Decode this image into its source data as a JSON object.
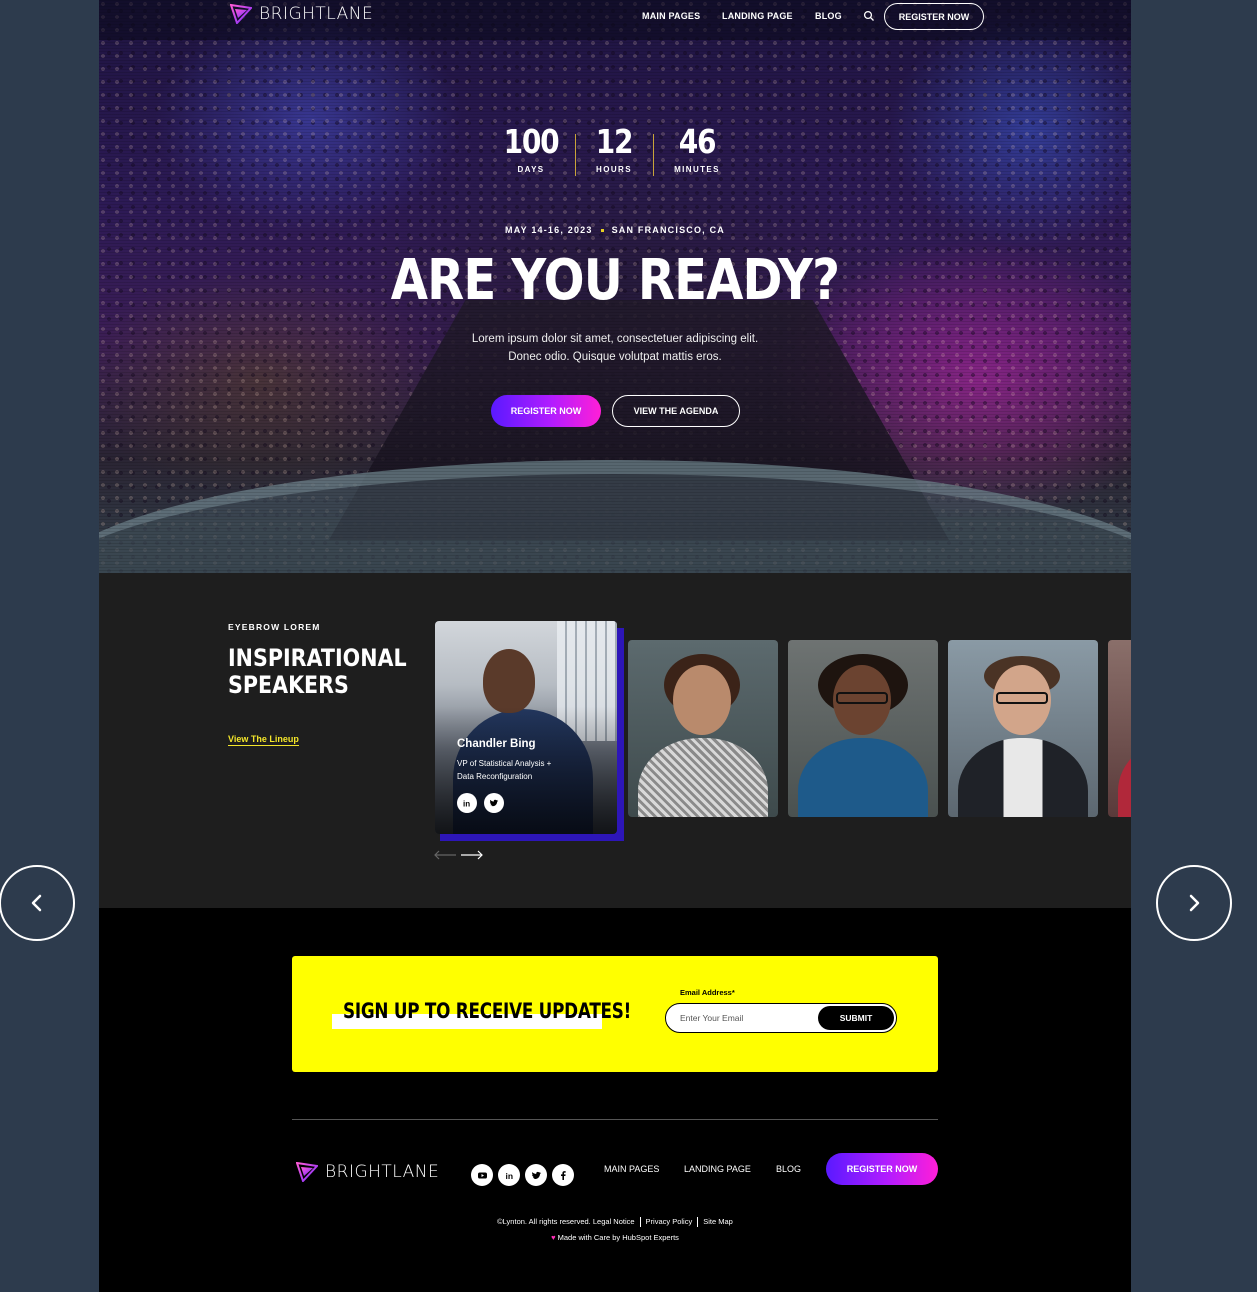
{
  "brand": {
    "name": "BRIGHTLANE",
    "accent_from": "#5a1aff",
    "accent_to": "#ff1fd7",
    "highlight": "#ffff00"
  },
  "nav": {
    "items": [
      "MAIN PAGES",
      "LANDING PAGE",
      "BLOG"
    ],
    "search_icon": "search-icon",
    "cta": "REGISTER NOW"
  },
  "hero": {
    "countdown": [
      {
        "value": "100",
        "label": "DAYS"
      },
      {
        "value": "12",
        "label": "HOURS"
      },
      {
        "value": "46",
        "label": "MINUTES"
      }
    ],
    "date": "MAY 14-16, 2023",
    "location": "SAN FRANCISCO, CA",
    "headline": "ARE YOU READY?",
    "copy_line1": "Lorem ipsum dolor sit amet, consectetuer adipiscing elit.",
    "copy_line2": "Donec odio. Quisque volutpat mattis eros.",
    "primary_cta": "REGISTER NOW",
    "secondary_cta": "VIEW THE AGENDA"
  },
  "speakers": {
    "eyebrow": "EYEBROW LOREM",
    "title_line1": "INSPIRATIONAL",
    "title_line2": "SPEAKERS",
    "link": "View The Lineup",
    "featured": {
      "name": "Chandler Bing",
      "role_line1": "VP of Statistical Analysis +",
      "role_line2": "Data Reconfiguration",
      "socials": [
        "linkedin-icon",
        "twitter-icon"
      ]
    }
  },
  "signup": {
    "title": "SIGN UP TO RECEIVE UPDATES!",
    "email_label": "Email Address*",
    "email_placeholder": "Enter Your Email",
    "submit": "SUBMIT"
  },
  "footer": {
    "socials": [
      "youtube-icon",
      "linkedin-icon",
      "twitter-icon",
      "facebook-icon"
    ],
    "nav": [
      "MAIN PAGES",
      "LANDING PAGE",
      "BLOG"
    ],
    "cta": "REGISTER NOW",
    "copyright": "©Lynton. All rights reserved. Legal Notice",
    "privacy": "Privacy Policy",
    "sitemap": "Site Map",
    "made_with": "Made with Care by HubSpot Experts"
  }
}
